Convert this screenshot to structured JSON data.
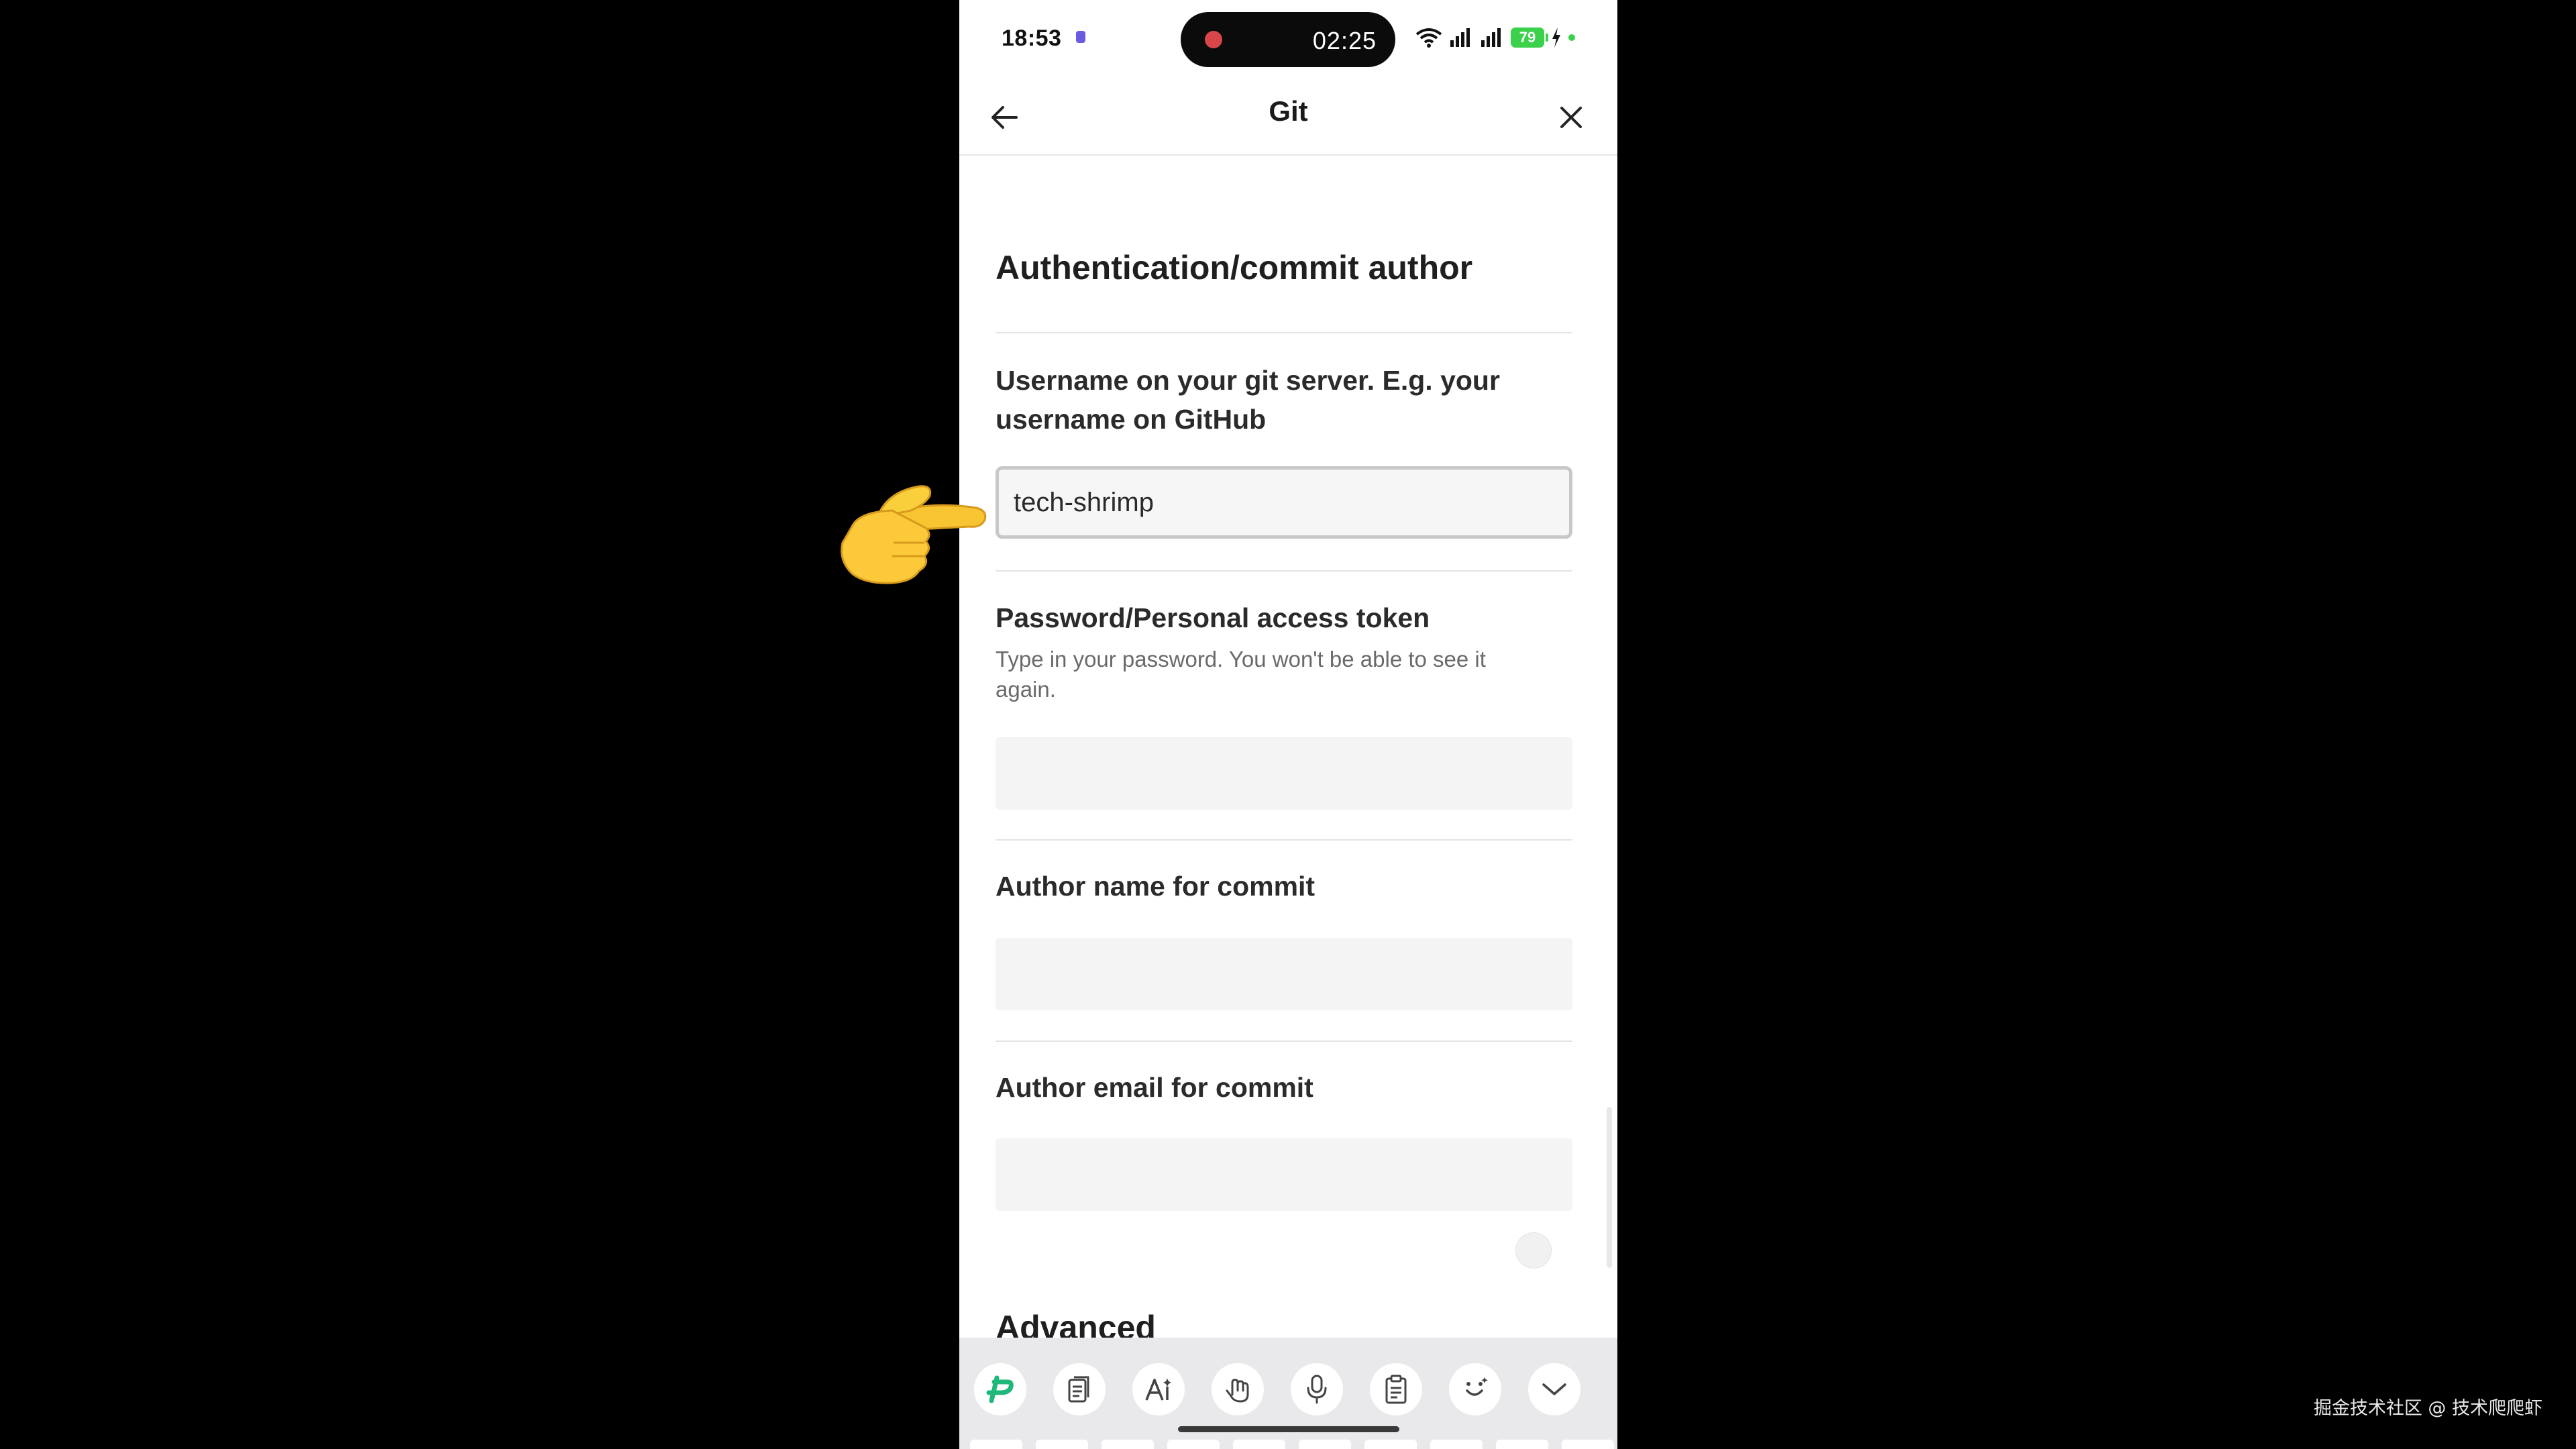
{
  "status_bar": {
    "time": "18:53",
    "recording_timer": "02:25",
    "battery": "79",
    "icons": [
      "app-notification-icon",
      "recording-dot-icon",
      "wifi-icon",
      "cellular-4g-icon",
      "cellular-5g-icon",
      "battery-icon",
      "charging-bolt-icon",
      "privacy-dot-icon"
    ]
  },
  "header": {
    "title": "Git",
    "back_icon": "arrow-left-icon",
    "close_icon": "close-icon"
  },
  "form": {
    "section_title": "Authentication/commit author",
    "username": {
      "label": "Username on your git server. E.g. your username on GitHub",
      "value": "tech-shrimp"
    },
    "password": {
      "label": "Password/Personal access token",
      "hint": "Type in your password. You won't be able to see it again.",
      "value": ""
    },
    "author_name": {
      "label": "Author name for commit",
      "value": ""
    },
    "author_email": {
      "label": "Author email for commit",
      "value": ""
    },
    "next_section_title": "Advanced"
  },
  "keyboard_toolbar": {
    "buttons": [
      "keyboard-logo-icon",
      "clipboard-doc-icon",
      "ai-text-icon",
      "handwriting-icon",
      "microphone-icon",
      "clipboard-icon",
      "emoji-icon",
      "collapse-chevron-icon"
    ],
    "accent": "#1fb87a"
  },
  "overlay": {
    "pointer": "pointing-hand-emoji",
    "watermark": "掘金技术社区 @ 技术爬爬虾"
  }
}
